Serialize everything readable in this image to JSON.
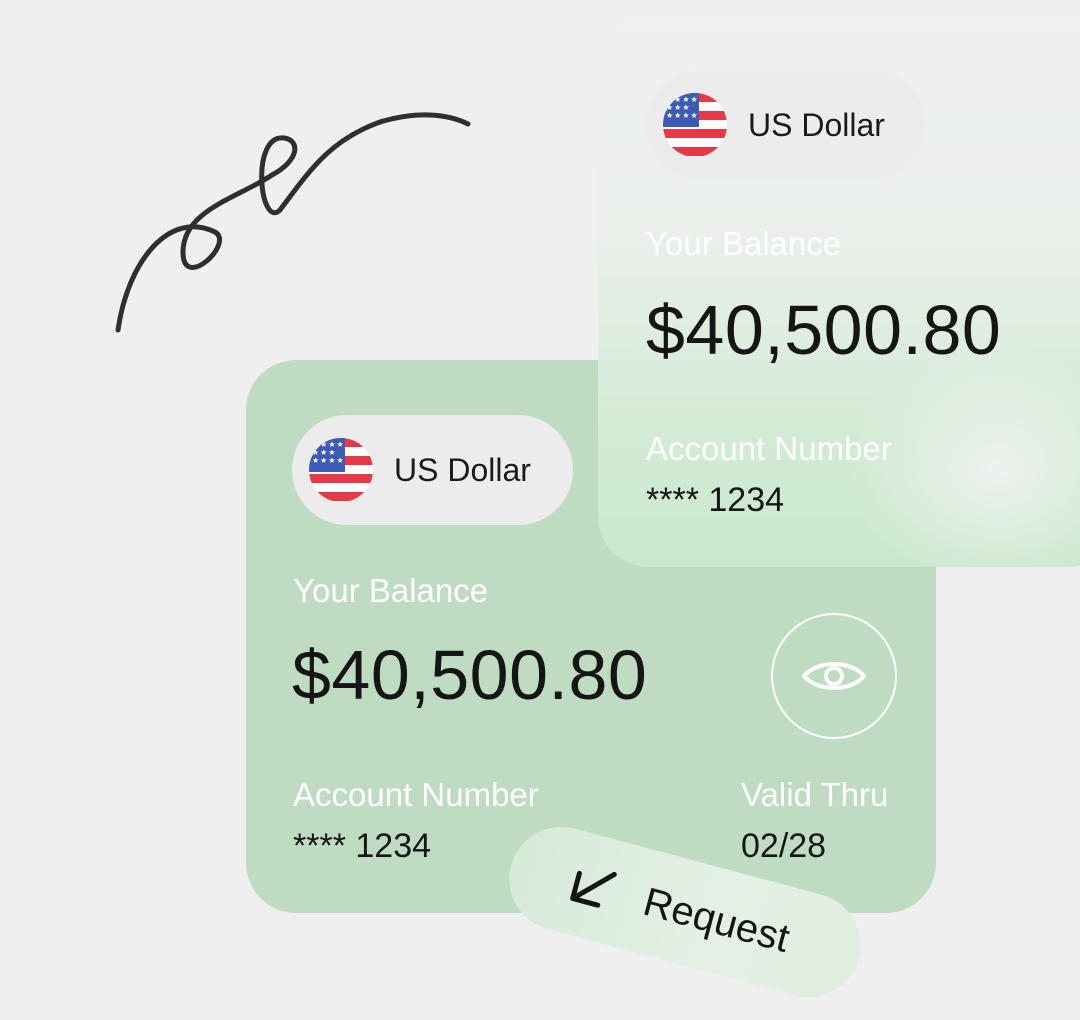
{
  "main_card": {
    "currency": "US Dollar",
    "balance_label": "Your Balance",
    "balance": "$40,500.80",
    "account_label": "Account Number",
    "account_number": "**** 1234",
    "valid_label": "Valid Thru",
    "valid_value": "02/28"
  },
  "top_card": {
    "currency": "US Dollar",
    "balance_label": "Your Balance",
    "balance": "$40,500.80",
    "account_label": "Account Number",
    "account_number": "**** 1234"
  },
  "actions": {
    "request_label": "Request"
  },
  "icons": {
    "flag": "us-flag-icon",
    "eye": "eye-icon",
    "request": "arrow-down-left-icon",
    "decoration": "squiggle-line"
  },
  "colors": {
    "background": "#efefef",
    "card_green": "#bfdcc2",
    "pill_bg": "#ececec",
    "text_dark": "#151515",
    "text_light": "#ffffff"
  }
}
